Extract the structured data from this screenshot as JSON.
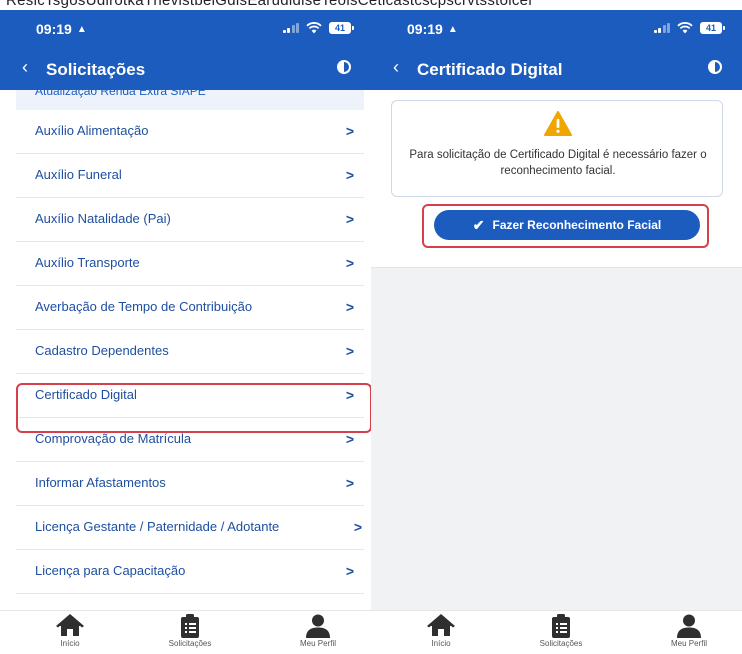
{
  "top_cut_text": "ReslcTsgosUdlrotkaTnevlstbelGdlsEarudldlseTeolsCetlcastcscpscrvtsstolcel",
  "colors": {
    "brand": "#1d5cbf",
    "highlight": "#d6404a",
    "warning": "#f0a500"
  },
  "status_bar": {
    "time": "09:19",
    "battery": "41"
  },
  "left": {
    "appbar": {
      "title": "Solicitações",
      "back_icon": "chevron-left-icon",
      "contrast_icon": "contrast-icon"
    },
    "partial_item": "Atualização Renda Extra SIAPE",
    "items": [
      {
        "label": "Auxílio Alimentação"
      },
      {
        "label": "Auxílio Funeral"
      },
      {
        "label": "Auxílio Natalidade (Pai)"
      },
      {
        "label": "Auxílio Transporte"
      },
      {
        "label": "Averbação de Tempo de Contribuição"
      },
      {
        "label": "Cadastro Dependentes"
      },
      {
        "label": "Certificado Digital"
      },
      {
        "label": "Comprovação de Matrícula"
      },
      {
        "label": "Informar Afastamentos"
      },
      {
        "label": "Licença Gestante / Paternidade / Adotante"
      },
      {
        "label": "Licença para Capacitação"
      }
    ],
    "chevron": ">",
    "highlighted_item": "Certificado Digital"
  },
  "right": {
    "appbar": {
      "title": "Certificado Digital"
    },
    "notice": "Para solicitação de Certificado Digital é necessário fazer o reconhecimento facial.",
    "button_label": "Fazer Reconhecimento Facial"
  },
  "bottom_nav": [
    {
      "label": "Início",
      "icon": "home-icon"
    },
    {
      "label": "Solicitações",
      "icon": "clipboard-list-icon"
    },
    {
      "label": "Meu Perfil",
      "icon": "user-icon"
    }
  ]
}
